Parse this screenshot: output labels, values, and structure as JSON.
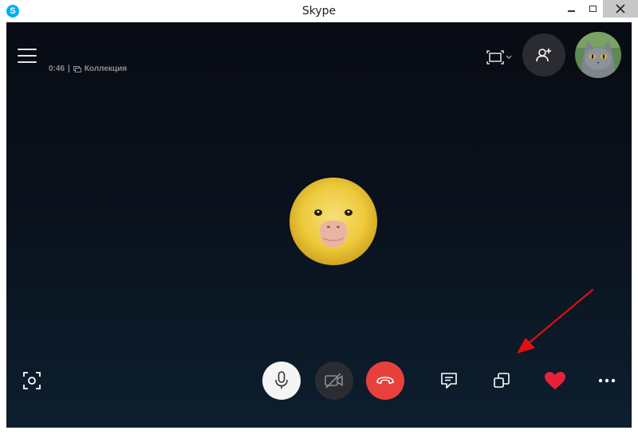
{
  "window": {
    "title": "Skype",
    "app_icon_letter": "S",
    "icon": "skype-logo-icon"
  },
  "call": {
    "duration": "0:46",
    "separator": "|",
    "collection_label": "Коллекция",
    "contact_avatar": "duckling-avatar",
    "self_avatar": "gray-cat-avatar"
  },
  "toolbar": {
    "items": [
      "snapshot-icon",
      "microphone-icon",
      "video-off-icon",
      "hang-up-icon",
      "chat-icon",
      "share-screen-icon",
      "heart-icon",
      "more-icon"
    ]
  },
  "colors": {
    "accent": "#00aff0",
    "hangup": "#e8403b",
    "heart": "#e8203a",
    "annotation_arrow": "#e01010"
  }
}
